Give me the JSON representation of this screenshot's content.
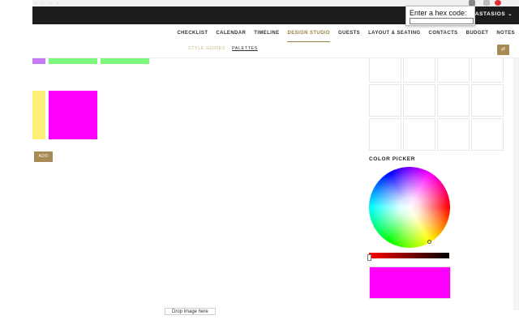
{
  "topbar": {
    "user_name": "ASTASIOS"
  },
  "navbar": {
    "items": [
      {
        "label": "CHECKLIST"
      },
      {
        "label": "CALENDAR"
      },
      {
        "label": "TIMELINE"
      },
      {
        "label": "DESIGN STUDIO",
        "active": true
      },
      {
        "label": "GUESTS"
      },
      {
        "label": "LAYOUT & SEATING"
      },
      {
        "label": "CONTACTS"
      },
      {
        "label": "BUDGET"
      },
      {
        "label": "NOTES"
      }
    ]
  },
  "subnav": {
    "tabs": [
      {
        "label": "STYLE GUIDES"
      },
      {
        "label": "PALETTES"
      }
    ],
    "button_icon": "share-icon"
  },
  "palette": {
    "swatch_colors": [
      "#c77af7",
      "#7cf87c",
      "#7cf87c",
      "#fdf07a",
      "#ff00ff"
    ],
    "add_label": "ADD"
  },
  "color_picker": {
    "title": "COLOR PICKER",
    "selected_color": "#ff00ff",
    "slider_from": "#ff0000",
    "slider_to": "#000000"
  },
  "hex_prompt": {
    "label": "Enter a hex code:",
    "value": ""
  },
  "drop_zone": {
    "label": "Drop image here"
  },
  "accent_color": "#a88b54"
}
